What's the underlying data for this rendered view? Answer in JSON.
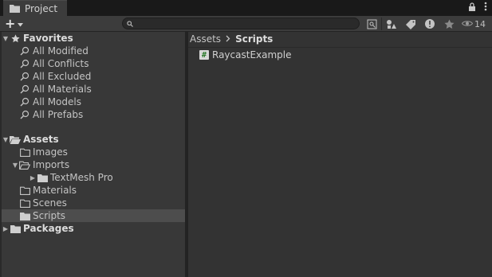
{
  "window": {
    "tab_title": "Project"
  },
  "toolbar": {
    "add_label": "+",
    "search_value": "",
    "hidden_count": "14"
  },
  "sidebar": {
    "favorites_label": "Favorites",
    "favorites": [
      "All Modified",
      "All Conflicts",
      "All Excluded",
      "All Materials",
      "All Models",
      "All Prefabs"
    ],
    "assets_label": "Assets",
    "assets_children": {
      "images": "Images",
      "imports": "Imports",
      "textmesh": "TextMesh Pro",
      "materials": "Materials",
      "scenes": "Scenes",
      "scripts": "Scripts"
    },
    "packages_label": "Packages",
    "selected": "Scripts"
  },
  "main": {
    "breadcrumb": {
      "root": "Assets",
      "current": "Scripts"
    },
    "files": [
      {
        "name": "RaycastExample",
        "icon": "csharp-script-icon"
      }
    ]
  }
}
